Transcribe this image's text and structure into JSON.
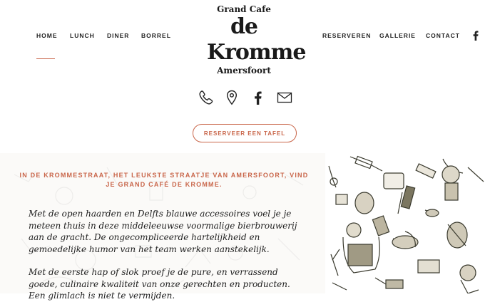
{
  "nav_left": [
    {
      "label": "HOME"
    },
    {
      "label": "LUNCH"
    },
    {
      "label": "DINER"
    },
    {
      "label": "BORREL"
    }
  ],
  "nav_right": [
    {
      "label": "RESERVEREN"
    },
    {
      "label": "GALLERIE"
    },
    {
      "label": "CONTACT"
    }
  ],
  "logo": {
    "top": "Grand Cafe",
    "main": "de Kromme",
    "bottom": "Amersfoort"
  },
  "icons": [
    "phone-icon",
    "map-pin-icon",
    "facebook-icon",
    "mail-icon"
  ],
  "cta_label": "RESERVEER EEN TAFEL",
  "lead_text": "IN DE KROMMESTRAAT, HET LEUKSTE STRAATJE VAN AMERSFOORT, VIND JE GRAND CAFÉ DE KROMME.",
  "paragraph_1": "Met de open haarden en Delfts blauwe accessoires voel je je meteen thuis in deze middeleeuwse voormalige bierbrouwerij aan de gracht. De ongecompliceerde hartelijkheid en gemoedelijke humor van het team werken aanstekelijk.",
  "paragraph_2": "Met de eerste hap of slok proef je de pure, en verrassend goede, culinaire kwaliteit van onze gerechten en producten. Een glimlach is niet te vermijden.",
  "colors": {
    "accent": "#c9664a",
    "text": "#222222"
  }
}
